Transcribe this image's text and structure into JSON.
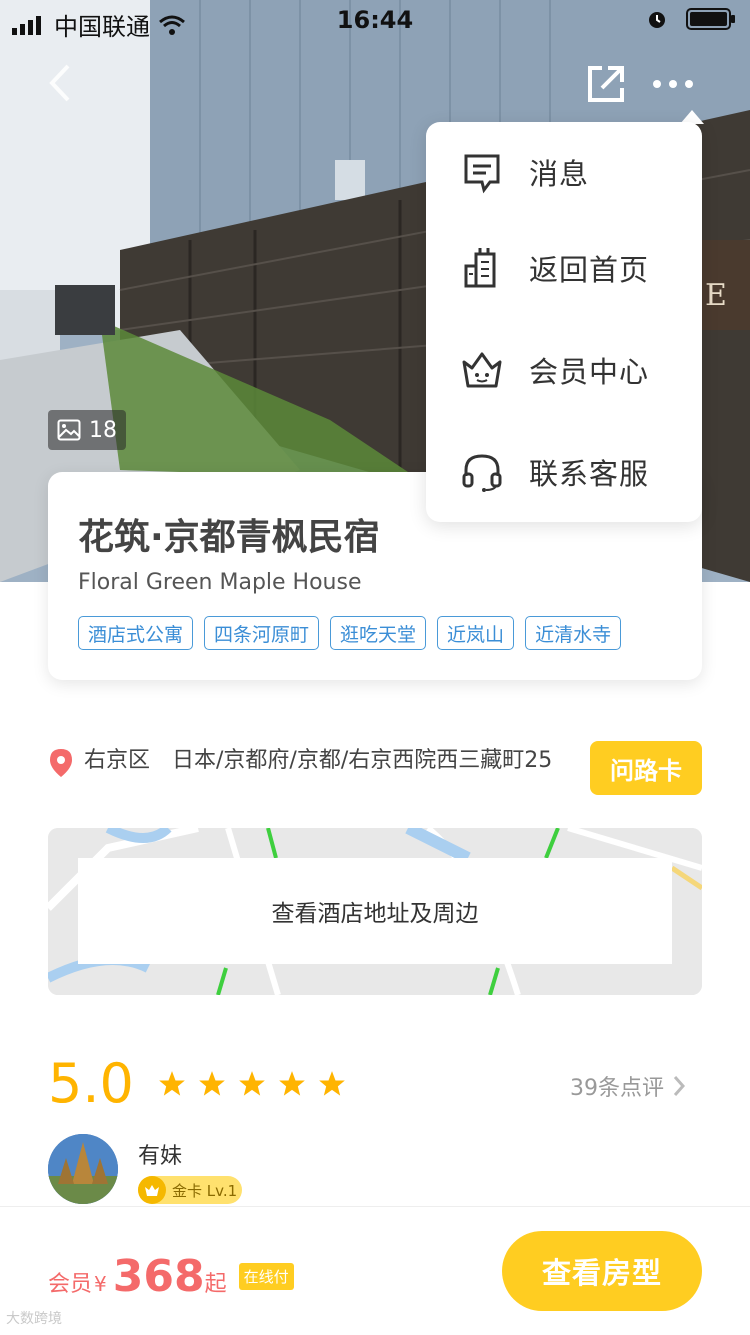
{
  "status_bar": {
    "carrier": "中国联通",
    "time": "16:44"
  },
  "hero": {
    "photo_count": "18"
  },
  "menu": {
    "items": [
      {
        "label": "消息",
        "icon": "message-icon"
      },
      {
        "label": "返回首页",
        "icon": "building-home-icon"
      },
      {
        "label": "会员中心",
        "icon": "crown-member-icon"
      },
      {
        "label": "联系客服",
        "icon": "headset-icon"
      }
    ]
  },
  "hotel": {
    "name_cn": "花筑·京都青枫民宿",
    "name_en": "Floral Green Maple House",
    "tags": [
      "酒店式公寓",
      "四条河原町",
      "逛吃天堂",
      "近岚山",
      "近清水寺"
    ]
  },
  "address": {
    "text": "右京区　日本/京都府/京都/右京西院西三藏町25",
    "card_button": "问路卡"
  },
  "map": {
    "label": "查看酒店地址及周边"
  },
  "rating": {
    "score": "5.0",
    "stars": 5,
    "review_count": "39条点评"
  },
  "review": {
    "user": "有妹",
    "level": "金卡 Lv.1"
  },
  "footer": {
    "member_label": "会员",
    "currency": "¥",
    "price": "368",
    "suffix": "起",
    "pay_badge": "在线付",
    "cta": "查看房型"
  },
  "watermark": "大数跨境",
  "colors": {
    "accent": "#ffcd21",
    "price": "#f46a6a",
    "tag": "#3b8ed6",
    "score": "#ffb400"
  }
}
